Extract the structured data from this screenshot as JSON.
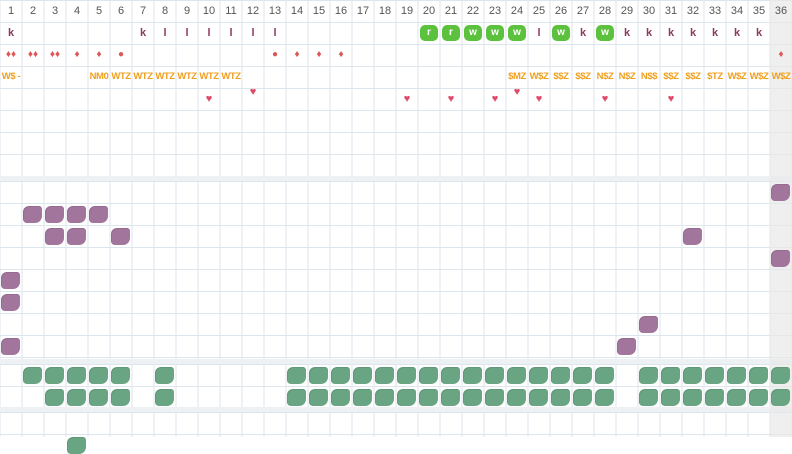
{
  "days": [
    "1",
    "2",
    "3",
    "4",
    "5",
    "6",
    "7",
    "8",
    "9",
    "10",
    "11",
    "12",
    "13",
    "14",
    "15",
    "16",
    "17",
    "18",
    "19",
    "20",
    "21",
    "22",
    "23",
    "24",
    "25",
    "26",
    "27",
    "28",
    "29",
    "30",
    "31",
    "32",
    "33",
    "34",
    "35",
    "36"
  ],
  "row1": [
    {
      "col": 1,
      "text": "k",
      "type": "k"
    },
    {
      "col": 7,
      "text": "k",
      "type": "k"
    },
    {
      "col": 8,
      "text": "l",
      "type": "l"
    },
    {
      "col": 9,
      "text": "l",
      "type": "l"
    },
    {
      "col": 10,
      "text": "l",
      "type": "l"
    },
    {
      "col": 11,
      "text": "l",
      "type": "l"
    },
    {
      "col": 12,
      "text": "l",
      "type": "l"
    },
    {
      "col": 13,
      "text": "l",
      "type": "l"
    },
    {
      "col": 20,
      "text": "r",
      "type": "green"
    },
    {
      "col": 21,
      "text": "r",
      "type": "green"
    },
    {
      "col": 22,
      "text": "w",
      "type": "green"
    },
    {
      "col": 23,
      "text": "w",
      "type": "green"
    },
    {
      "col": 24,
      "text": "w",
      "type": "green"
    },
    {
      "col": 25,
      "text": "l",
      "type": "l"
    },
    {
      "col": 26,
      "text": "w",
      "type": "green"
    },
    {
      "col": 27,
      "text": "k",
      "type": "k"
    },
    {
      "col": 28,
      "text": "w",
      "type": "green"
    },
    {
      "col": 29,
      "text": "k",
      "type": "k"
    },
    {
      "col": 30,
      "text": "k",
      "type": "k"
    },
    {
      "col": 31,
      "text": "k",
      "type": "k"
    },
    {
      "col": 32,
      "text": "k",
      "type": "k"
    },
    {
      "col": 33,
      "text": "k",
      "type": "k"
    },
    {
      "col": 34,
      "text": "k",
      "type": "k"
    },
    {
      "col": 35,
      "text": "k",
      "type": "k"
    }
  ],
  "row2": [
    {
      "col": 1,
      "text": "♦♦"
    },
    {
      "col": 2,
      "text": "♦♦"
    },
    {
      "col": 3,
      "text": "♦♦"
    },
    {
      "col": 4,
      "text": "♦"
    },
    {
      "col": 5,
      "text": "♦"
    },
    {
      "col": 6,
      "text": "●"
    },
    {
      "col": 13,
      "text": "●"
    },
    {
      "col": 14,
      "text": "♦"
    },
    {
      "col": 15,
      "text": "♦"
    },
    {
      "col": 16,
      "text": "♦"
    },
    {
      "col": 36,
      "text": "♦"
    }
  ],
  "row3": [
    {
      "col": 1,
      "text": "W$ -"
    },
    {
      "col": 5,
      "text": "NM0"
    },
    {
      "col": 6,
      "text": "WTZ"
    },
    {
      "col": 7,
      "text": "WTZ"
    },
    {
      "col": 8,
      "text": "WTZ"
    },
    {
      "col": 9,
      "text": "WTZ"
    },
    {
      "col": 10,
      "text": "WTZ"
    },
    {
      "col": 11,
      "text": "WTZ"
    },
    {
      "col": 24,
      "text": "$MZ"
    },
    {
      "col": 25,
      "text": "W$Z"
    },
    {
      "col": 26,
      "text": "$$Z"
    },
    {
      "col": 27,
      "text": "$$Z"
    },
    {
      "col": 28,
      "text": "N$Z"
    },
    {
      "col": 29,
      "text": "N$Z"
    },
    {
      "col": 30,
      "text": "N$$"
    },
    {
      "col": 31,
      "text": "$$Z"
    },
    {
      "col": 32,
      "text": "$$Z"
    },
    {
      "col": 33,
      "text": "$TZ"
    },
    {
      "col": 34,
      "text": "W$Z"
    },
    {
      "col": 35,
      "text": "W$Z"
    },
    {
      "col": 36,
      "text": "W$Z"
    }
  ],
  "hearts": [
    {
      "col": 10,
      "row": 4
    },
    {
      "col": 12,
      "row": 3.7
    },
    {
      "col": 19,
      "row": 4
    },
    {
      "col": 21,
      "row": 4
    },
    {
      "col": 23,
      "row": 4
    },
    {
      "col": 24,
      "row": 3.7
    },
    {
      "col": 25,
      "row": 4
    },
    {
      "col": 28,
      "row": 4
    },
    {
      "col": 31,
      "row": 4
    }
  ],
  "purple_blobs": [
    {
      "col": 36,
      "row": 8
    },
    {
      "col": 2,
      "row": 9
    },
    {
      "col": 3,
      "row": 9
    },
    {
      "col": 4,
      "row": 9
    },
    {
      "col": 5,
      "row": 9
    },
    {
      "col": 3,
      "row": 10
    },
    {
      "col": 4,
      "row": 10
    },
    {
      "col": 6,
      "row": 10
    },
    {
      "col": 32,
      "row": 10
    },
    {
      "col": 36,
      "row": 11
    },
    {
      "col": 1,
      "row": 12
    },
    {
      "col": 1,
      "row": 13
    },
    {
      "col": 30,
      "row": 14
    },
    {
      "col": 1,
      "row": 15
    },
    {
      "col": 29,
      "row": 15
    }
  ],
  "teal_blobs": [
    {
      "col": 2,
      "row": 16
    },
    {
      "col": 3,
      "row": 16
    },
    {
      "col": 4,
      "row": 16
    },
    {
      "col": 5,
      "row": 16
    },
    {
      "col": 6,
      "row": 16
    },
    {
      "col": 8,
      "row": 16
    },
    {
      "col": 14,
      "row": 16
    },
    {
      "col": 15,
      "row": 16
    },
    {
      "col": 16,
      "row": 16
    },
    {
      "col": 17,
      "row": 16
    },
    {
      "col": 18,
      "row": 16
    },
    {
      "col": 19,
      "row": 16
    },
    {
      "col": 20,
      "row": 16
    },
    {
      "col": 21,
      "row": 16
    },
    {
      "col": 22,
      "row": 16
    },
    {
      "col": 23,
      "row": 16
    },
    {
      "col": 24,
      "row": 16
    },
    {
      "col": 25,
      "row": 16
    },
    {
      "col": 26,
      "row": 16
    },
    {
      "col": 27,
      "row": 16
    },
    {
      "col": 28,
      "row": 16
    },
    {
      "col": 30,
      "row": 16
    },
    {
      "col": 31,
      "row": 16
    },
    {
      "col": 32,
      "row": 16
    },
    {
      "col": 33,
      "row": 16
    },
    {
      "col": 34,
      "row": 16
    },
    {
      "col": 35,
      "row": 16
    },
    {
      "col": 36,
      "row": 16
    },
    {
      "col": 3,
      "row": 17
    },
    {
      "col": 4,
      "row": 17
    },
    {
      "col": 5,
      "row": 17
    },
    {
      "col": 6,
      "row": 17
    },
    {
      "col": 8,
      "row": 17
    },
    {
      "col": 14,
      "row": 17
    },
    {
      "col": 15,
      "row": 17
    },
    {
      "col": 16,
      "row": 17
    },
    {
      "col": 17,
      "row": 17
    },
    {
      "col": 18,
      "row": 17
    },
    {
      "col": 19,
      "row": 17
    },
    {
      "col": 20,
      "row": 17
    },
    {
      "col": 21,
      "row": 17
    },
    {
      "col": 22,
      "row": 17
    },
    {
      "col": 23,
      "row": 17
    },
    {
      "col": 24,
      "row": 17
    },
    {
      "col": 25,
      "row": 17
    },
    {
      "col": 26,
      "row": 17
    },
    {
      "col": 27,
      "row": 17
    },
    {
      "col": 28,
      "row": 17
    },
    {
      "col": 30,
      "row": 17
    },
    {
      "col": 31,
      "row": 17
    },
    {
      "col": 32,
      "row": 17
    },
    {
      "col": 33,
      "row": 17
    },
    {
      "col": 34,
      "row": 17
    },
    {
      "col": 35,
      "row": 17
    },
    {
      "col": 36,
      "row": 17
    },
    {
      "col": 4,
      "row": 19
    }
  ],
  "colors": {
    "grid_line": "#dde6ec",
    "separator": "#eef1f3",
    "purple": "#a2759c",
    "teal": "#6aa583",
    "green_tag": "#5cc13d",
    "code_orange": "#f0a020",
    "k_color": "#8b3a62",
    "drop_red": "#e05555",
    "heart_pink": "#e04a6a"
  },
  "icons": {
    "drop": "drop-icon",
    "heart": "heart-icon",
    "blob": "blob-marker"
  }
}
